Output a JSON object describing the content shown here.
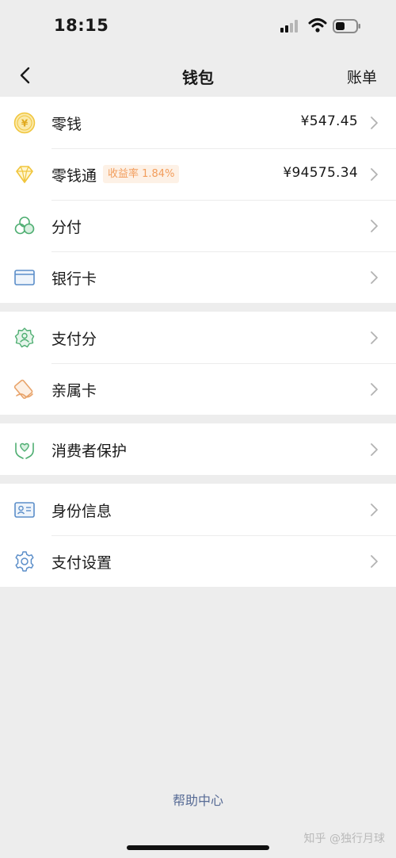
{
  "status_bar": {
    "time": "18:15"
  },
  "nav": {
    "title": "钱包",
    "right_action": "账单"
  },
  "groups": [
    {
      "rows": [
        {
          "label": "零钱",
          "value": "¥547.45",
          "icon": "yuan-coin-icon"
        },
        {
          "label": "零钱通",
          "badge": "收益率 1.84%",
          "value": "¥94575.34",
          "icon": "diamond-icon"
        },
        {
          "label": "分付",
          "icon": "clover-icon"
        },
        {
          "label": "银行卡",
          "icon": "bank-card-icon"
        }
      ]
    },
    {
      "rows": [
        {
          "label": "支付分",
          "icon": "badge-score-icon"
        },
        {
          "label": "亲属卡",
          "icon": "family-card-icon"
        }
      ]
    },
    {
      "rows": [
        {
          "label": "消费者保护",
          "icon": "hands-protect-icon"
        }
      ]
    },
    {
      "rows": [
        {
          "label": "身份信息",
          "icon": "id-card-icon"
        },
        {
          "label": "支付设置",
          "icon": "gear-icon"
        }
      ]
    }
  ],
  "footer": {
    "help": "帮助中心",
    "watermark": "知乎 @独行月球"
  },
  "colors": {
    "background": "#ededed",
    "card": "#ffffff",
    "coin_yellow": "#f0c53c",
    "green_icon": "#4fae72",
    "blue_icon": "#5b8ec9",
    "orange_icon": "#e8a36a",
    "badge_text": "#f29d5c",
    "link_blue": "#576b95"
  }
}
